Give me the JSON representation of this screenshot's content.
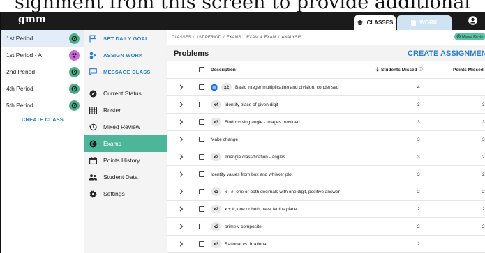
{
  "banner_text": "signment from this screen to provide additional",
  "app": {
    "logo": "gmm"
  },
  "tabs": [
    {
      "label": "CLASSES",
      "icon": "graduation-cap-icon"
    },
    {
      "label": "WORK",
      "icon": "document-icon"
    }
  ],
  "classes": [
    {
      "name": "1st Period",
      "badge": "history-icon",
      "color": "#4caf89"
    },
    {
      "name": "1st Period - A",
      "badge": "group-icon",
      "color": "#c56ad3"
    },
    {
      "name": "2nd Period",
      "badge": "history-icon",
      "color": "#4caf89"
    },
    {
      "name": "4th Period",
      "badge": "history-icon",
      "color": "#4caf89"
    },
    {
      "name": "5th Period",
      "badge": "history-icon",
      "color": "#4caf89"
    }
  ],
  "create_class_label": "CREATE CLASS",
  "nav": {
    "actions": [
      {
        "label": "SET DAILY GOAL",
        "icon": "flag-icon"
      },
      {
        "label": "ASSIGN WORK",
        "icon": "assign-icon"
      },
      {
        "label": "MESSAGE CLASS",
        "icon": "message-icon"
      }
    ],
    "items": [
      {
        "label": "Current Status",
        "icon": "compass-icon"
      },
      {
        "label": "Roster",
        "icon": "grid-icon"
      },
      {
        "label": "Mixed Review",
        "icon": "history-icon"
      },
      {
        "label": "Exams",
        "icon": "exam-icon"
      },
      {
        "label": "Points History",
        "icon": "calendar-icon"
      },
      {
        "label": "Student Data",
        "icon": "people-icon"
      },
      {
        "label": "Settings",
        "icon": "gear-icon"
      }
    ]
  },
  "breadcrumb": [
    "CLASSES",
    "1ST PERIOD",
    "EXAMS",
    "EXAM 4: EXAM",
    "ANALYSIS"
  ],
  "mixed_review_pill": "Mixed Revie",
  "problems_title": "Problems",
  "create_assignment": "CREATE ASSIGNMENT",
  "table": {
    "headers": {
      "description": "Description",
      "students_missed": "Students Missed",
      "points_missed": "Points Missed"
    },
    "rows": [
      {
        "mult": "x2",
        "hex": true,
        "description": "Basic integer multiplication and division, condensed",
        "students_missed": "4",
        "points_missed": ""
      },
      {
        "mult": "x4",
        "hex": false,
        "description": "Identify place of given digit",
        "students_missed": "3",
        "points_missed": "3"
      },
      {
        "mult": "x3",
        "hex": false,
        "description": "Find missing angle - images provided",
        "students_missed": "3",
        "points_missed": "3."
      },
      {
        "mult": "",
        "hex": false,
        "description": "Make change",
        "students_missed": "3",
        "points_missed": "3"
      },
      {
        "mult": "x2",
        "hex": false,
        "description": "Triangle classification - angles",
        "students_missed": "3",
        "points_missed": "2."
      },
      {
        "mult": "",
        "hex": false,
        "description": "Identify values from box and whisker plot",
        "students_missed": "3",
        "points_missed": "2."
      },
      {
        "mult": "x3",
        "hex": false,
        "description": "x - #, one or both decimals with one digit, positive answer",
        "students_missed": "2",
        "points_missed": "2"
      },
      {
        "mult": "x2",
        "hex": false,
        "description": "x + #, one or both have tenths place",
        "students_missed": "2",
        "points_missed": "2"
      },
      {
        "mult": "x2",
        "hex": false,
        "description": "prime v composite",
        "students_missed": "2",
        "points_missed": "2"
      },
      {
        "mult": "x3",
        "hex": false,
        "description": "Rational vs. Irrational",
        "students_missed": "2",
        "points_missed": ""
      }
    ]
  }
}
